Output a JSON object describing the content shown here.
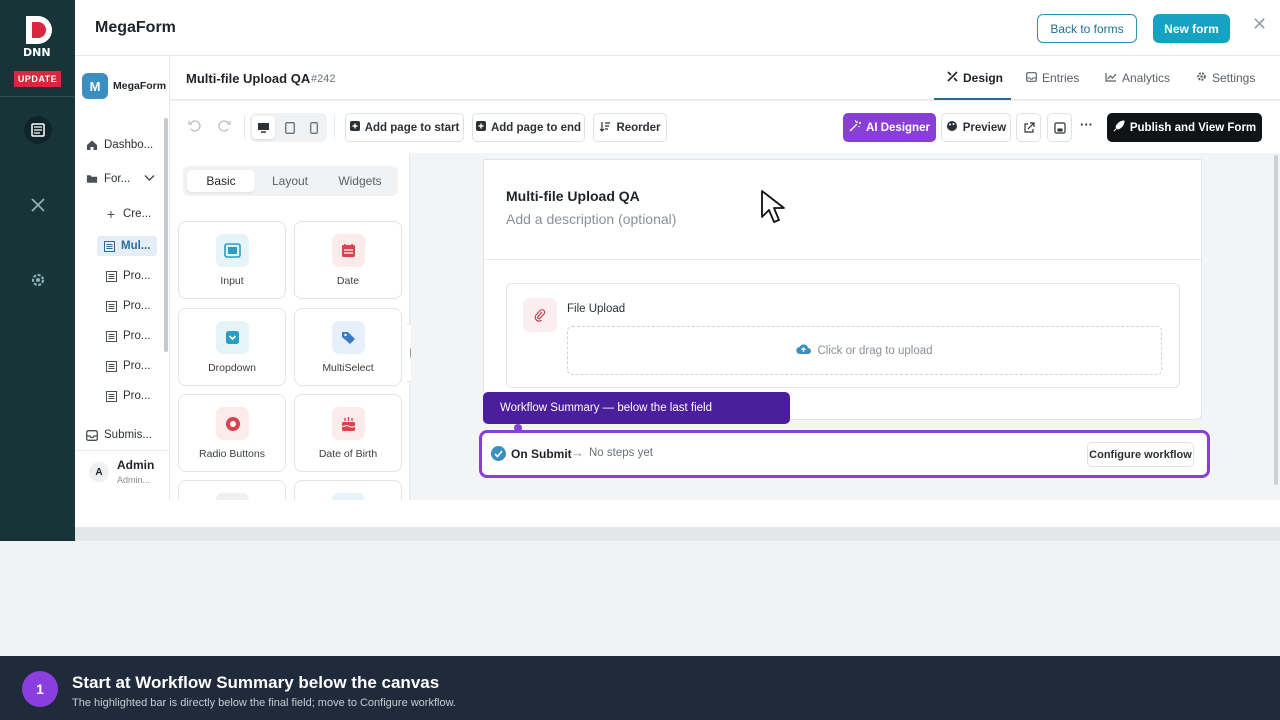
{
  "rail": {
    "update_label": "UPDATE",
    "logo_text": "DNN"
  },
  "topbar": {
    "app_title": "MegaForm",
    "back_label": "Back to forms",
    "new_label": "New form"
  },
  "sidebar": {
    "brand_initial": "M",
    "brand_name": "MegaForm",
    "items": [
      {
        "label": "Dashbo...",
        "icon": "home-icon"
      },
      {
        "label": "For...",
        "icon": "folder-open-icon"
      },
      {
        "label": "Cre...",
        "icon": "plus-icon"
      },
      {
        "label": "Mul...",
        "icon": "form-icon"
      },
      {
        "label": "Pro...",
        "icon": "form-icon"
      },
      {
        "label": "Pro...",
        "icon": "form-icon"
      },
      {
        "label": "Pro...",
        "icon": "form-icon"
      },
      {
        "label": "Pro...",
        "icon": "form-icon"
      },
      {
        "label": "Pro...",
        "icon": "form-icon"
      },
      {
        "label": "Submis...",
        "icon": "inbox-icon"
      }
    ],
    "user_initial": "A",
    "user_name": "Admin",
    "user_sub": "Admin..."
  },
  "header": {
    "form_title": "Multi-file Upload QA",
    "form_id": "#242",
    "tabs": [
      {
        "label": "Design",
        "icon": "design-icon",
        "active": true
      },
      {
        "label": "Entries",
        "icon": "entries-icon",
        "active": false
      },
      {
        "label": "Analytics",
        "icon": "analytics-icon",
        "active": false
      },
      {
        "label": "Settings",
        "icon": "gear-icon",
        "active": false
      }
    ]
  },
  "toolbar": {
    "add_start": "Add page to start",
    "add_end": "Add page to end",
    "reorder": "Reorder",
    "ai_designer": "AI Designer",
    "preview": "Preview",
    "more": "···",
    "publish": "Publish and View Form"
  },
  "palette": {
    "tabs": [
      "Basic",
      "Layout",
      "Widgets"
    ],
    "active_tab": "Basic",
    "cards": [
      {
        "label": "Input",
        "icon": "input-icon"
      },
      {
        "label": "Date",
        "icon": "calendar-icon"
      },
      {
        "label": "Dropdown",
        "icon": "dropdown-icon"
      },
      {
        "label": "MultiSelect",
        "icon": "tags-icon"
      },
      {
        "label": "Radio Buttons",
        "icon": "radio-icon"
      },
      {
        "label": "Date of Birth",
        "icon": "cake-icon"
      }
    ]
  },
  "canvas": {
    "form_title": "Multi-file Upload QA",
    "description_placeholder": "Add a description (optional)",
    "field_label": "File Upload",
    "drop_text": "Click or drag to upload"
  },
  "workflow": {
    "tooltip": "Workflow Summary — below the last field",
    "on_submit": "On Submit",
    "arrow": "→",
    "status": "No steps yet",
    "configure": "Configure workflow"
  },
  "footer": {
    "step_number": "1",
    "heading": "Start at Workflow Summary below the canvas",
    "sub": "The highlighted bar is directly below the final field; move to Configure workflow."
  },
  "colors": {
    "accent": "#17a2c4",
    "highlight": "#8a3ed8",
    "rail": "#173539",
    "footer": "#1f2a3a"
  }
}
